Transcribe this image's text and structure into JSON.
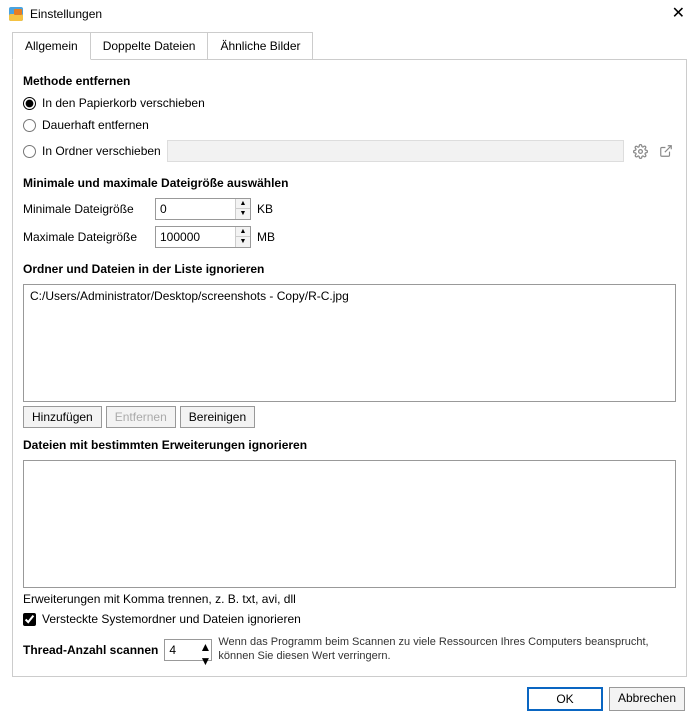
{
  "title": "Einstellungen",
  "tabs": {
    "general": "Allgemein",
    "duplicates": "Doppelte Dateien",
    "similar": "Ähnliche Bilder"
  },
  "remove": {
    "title": "Methode entfernen",
    "recycle": "In den Papierkorb verschieben",
    "permanent": "Dauerhaft entfernen",
    "moveFolder": "In Ordner verschieben",
    "folderPath": ""
  },
  "size": {
    "title": "Minimale und maximale Dateigröße auswählen",
    "minLabel": "Minimale Dateigröße",
    "minValue": "0",
    "minUnit": "KB",
    "maxLabel": "Maximale Dateigröße",
    "maxValue": "100000",
    "maxUnit": "MB"
  },
  "ignore": {
    "title": "Ordner und Dateien in der Liste ignorieren",
    "items": [
      "C:/Users/Administrator/Desktop/screenshots - Copy/R-C.jpg"
    ],
    "add": "Hinzufügen",
    "remove": "Entfernen",
    "cleanup": "Bereinigen"
  },
  "ext": {
    "title": "Dateien mit bestimmten Erweiterungen ignorieren",
    "value": "",
    "hint": "Erweiterungen mit Komma trennen, z. B. txt, avi, dll"
  },
  "hidden": {
    "label": "Versteckte Systemordner und Dateien ignorieren",
    "checked": true
  },
  "thread": {
    "label": "Thread-Anzahl scannen",
    "value": "4",
    "hint": "Wenn das Programm beim Scannen zu viele Ressourcen Ihres Computers beansprucht, können Sie diesen Wert verringern."
  },
  "footer": {
    "ok": "OK",
    "cancel": "Abbrechen"
  }
}
